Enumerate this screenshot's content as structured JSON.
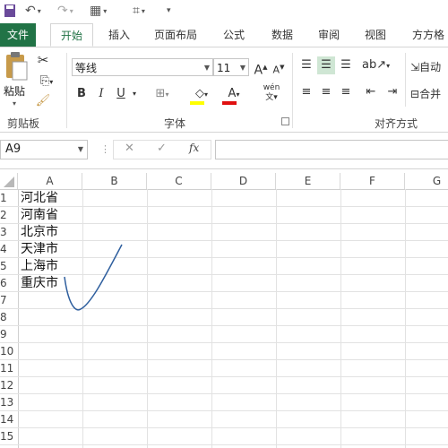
{
  "tabs": [
    "文件",
    "开始",
    "插入",
    "页面布局",
    "公式",
    "数据",
    "审阅",
    "视图",
    "方方格"
  ],
  "ribbon": {
    "clipboard": {
      "paste": "粘贴",
      "label": "剪贴板"
    },
    "font": {
      "name": "等线",
      "size": "11",
      "grow": "A",
      "shrink": "A",
      "bold": "B",
      "italic": "I",
      "underline": "U",
      "font_color": "A",
      "phonetic": "wén",
      "label": "字体"
    },
    "alignment": {
      "wrap": "自动",
      "merge": "合并",
      "label": "对齐方式"
    }
  },
  "formula_bar": {
    "name_box": "A9",
    "fx": "fx",
    "cancel": "✕",
    "confirm": "✓"
  },
  "sheet": {
    "columns": [
      "A",
      "B",
      "C",
      "D",
      "E",
      "F",
      "G"
    ],
    "rows": [
      "1",
      "2",
      "3",
      "4",
      "5",
      "6",
      "7",
      "8",
      "9",
      "10",
      "11",
      "12",
      "13",
      "14",
      "15"
    ],
    "cells": [
      "河北省",
      "河南省",
      "北京市",
      "天津市",
      "上海市",
      "重庆市"
    ]
  },
  "colors": {
    "excel_green": "#217346",
    "annotation_blue": "#2f5f9e",
    "highlight": "#ffff00",
    "font_red": "#e01010"
  }
}
